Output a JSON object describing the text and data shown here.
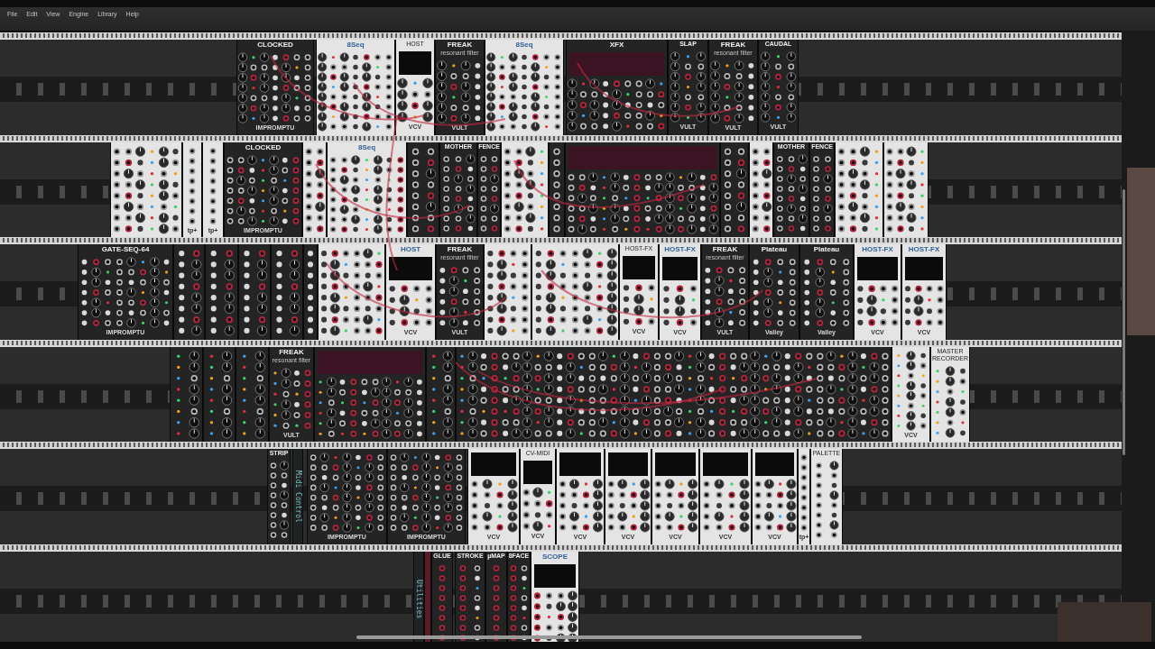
{
  "menu_bar": {
    "items": [
      "File",
      "Edit",
      "View",
      "Engine",
      "Library",
      "Help"
    ]
  },
  "rack": {
    "rows": [
      {
        "modules": [
          {
            "kind": "dark",
            "title": "CLOCKED",
            "footer": "IMPROMPTU"
          },
          {
            "kind": "light",
            "title": "8Seq"
          },
          {
            "kind": "light",
            "title": "HOST",
            "footer": "VCV"
          },
          {
            "kind": "dark",
            "title": "FREAK",
            "subtitle": "resonant filter",
            "footer": "VULT"
          },
          {
            "kind": "light",
            "title": "8Seq"
          },
          {
            "kind": "dark",
            "title": "XFX"
          },
          {
            "kind": "dark",
            "title": "SLAP",
            "footer": "VULT"
          },
          {
            "kind": "dark",
            "title": "FREAK",
            "subtitle": "resonant filter",
            "footer": "VULT"
          },
          {
            "kind": "dark",
            "title": "CAUDAL",
            "footer": "VULT"
          }
        ]
      },
      {
        "modules": [
          {
            "kind": "light"
          },
          {
            "kind": "light",
            "footer": "tp+"
          },
          {
            "kind": "light",
            "footer": "tp+"
          },
          {
            "kind": "dark",
            "title": "CLOCKED",
            "footer": "IMPROMPTU"
          },
          {
            "kind": "light"
          },
          {
            "kind": "light",
            "title": "8Seq"
          },
          {
            "kind": "dark"
          },
          {
            "kind": "dark",
            "title": "MOTHER"
          },
          {
            "kind": "dark",
            "title": "FENCE"
          },
          {
            "kind": "light"
          },
          {
            "kind": "dark"
          },
          {
            "kind": "dark"
          },
          {
            "kind": "dark"
          },
          {
            "kind": "light"
          },
          {
            "kind": "dark",
            "title": "MOTHER"
          },
          {
            "kind": "dark",
            "title": "FENCE"
          },
          {
            "kind": "light"
          },
          {
            "kind": "light"
          }
        ]
      },
      {
        "modules": [
          {
            "kind": "dark",
            "title": "GATE-SEQ-64",
            "footer": "IMPROMPTU"
          },
          {
            "kind": "dark"
          },
          {
            "kind": "dark"
          },
          {
            "kind": "dark"
          },
          {
            "kind": "dark"
          },
          {
            "kind": "dark"
          },
          {
            "kind": "light"
          },
          {
            "kind": "light",
            "title": "HOST",
            "footer": "VCV"
          },
          {
            "kind": "dark",
            "title": "FREAK",
            "subtitle": "resonant filter",
            "footer": "VULT"
          },
          {
            "kind": "light"
          },
          {
            "kind": "light"
          },
          {
            "kind": "light",
            "title": "HOST-FX",
            "footer": "VCV"
          },
          {
            "kind": "light",
            "title": "HOST-FX",
            "footer": "VCV"
          },
          {
            "kind": "dark",
            "title": "FREAK",
            "subtitle": "resonant filter",
            "footer": "VULT"
          },
          {
            "kind": "dark",
            "title": "Plateau",
            "footer": "Valley"
          },
          {
            "kind": "dark",
            "title": "Plateau",
            "footer": "Valley"
          },
          {
            "kind": "light",
            "title": "HOST-FX",
            "footer": "VCV"
          },
          {
            "kind": "light",
            "title": "HOST-FX",
            "footer": "VCV"
          }
        ]
      },
      {
        "modules": [
          {
            "kind": "dark"
          },
          {
            "kind": "dark"
          },
          {
            "kind": "dark"
          },
          {
            "kind": "dark",
            "title": "FREAK",
            "subtitle": "resonant filter",
            "footer": "VULT"
          },
          {
            "kind": "dark"
          },
          {
            "kind": "dark"
          },
          {
            "kind": "dark"
          },
          {
            "kind": "light",
            "footer": "VCV"
          },
          {
            "kind": "light",
            "title": "MASTER RECORDER"
          }
        ]
      },
      {
        "modules": [
          {
            "kind": "dark",
            "title": "STRIP"
          },
          {
            "kind": "label",
            "title": "Midi Control"
          },
          {
            "kind": "dark",
            "footer": "IMPROMPTU"
          },
          {
            "kind": "dark",
            "footer": "IMPROMPTU"
          },
          {
            "kind": "light",
            "footer": "VCV"
          },
          {
            "kind": "light",
            "title": "CV-MIDI",
            "footer": "VCV"
          },
          {
            "kind": "light",
            "footer": "VCV"
          },
          {
            "kind": "light",
            "footer": "VCV"
          },
          {
            "kind": "light",
            "footer": "VCV"
          },
          {
            "kind": "light",
            "footer": "VCV"
          },
          {
            "kind": "light",
            "footer": "VCV"
          },
          {
            "kind": "light",
            "footer": "tp+"
          },
          {
            "kind": "light",
            "title": "PALETTE"
          }
        ]
      },
      {
        "modules": [
          {
            "kind": "label",
            "title": "Utilities"
          },
          {
            "kind": "blank"
          },
          {
            "kind": "dark",
            "title": "GLUE"
          },
          {
            "kind": "dark",
            "title": "STROKE"
          },
          {
            "kind": "dark",
            "title": "µMAP"
          },
          {
            "kind": "dark",
            "title": "8FACE"
          },
          {
            "kind": "light",
            "title": "SCOPE"
          }
        ]
      }
    ]
  }
}
